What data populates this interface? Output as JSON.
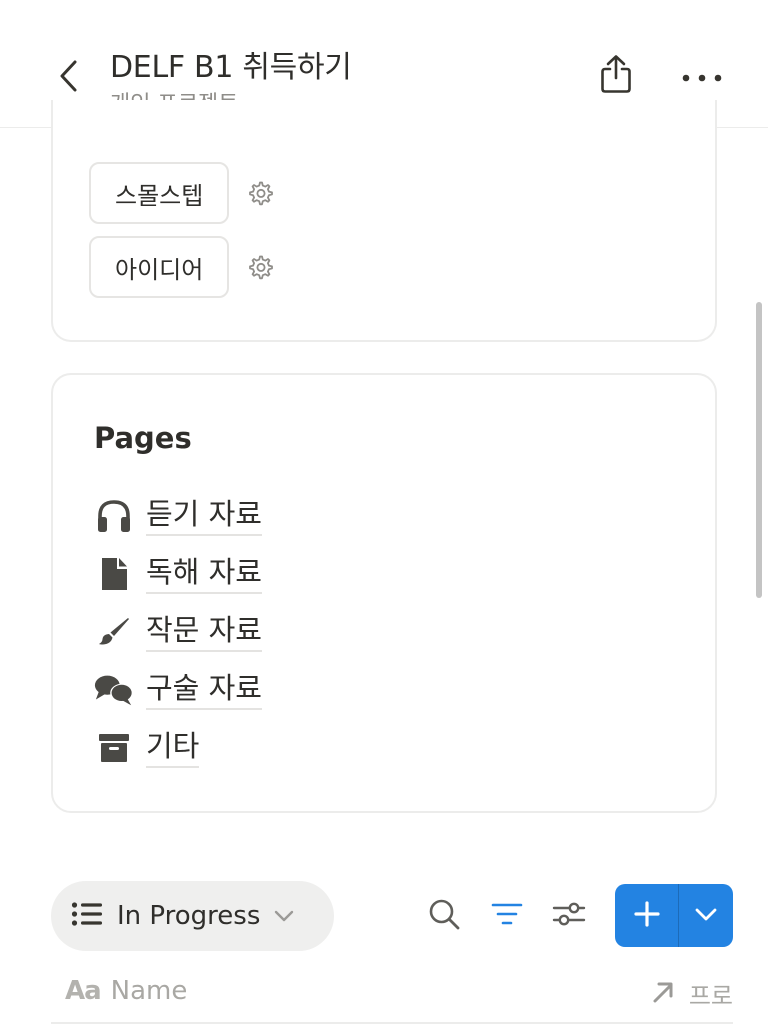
{
  "header": {
    "title": "DELF B1 취득하기",
    "subtitle": "개인 프로젝트",
    "icons": {
      "back": "chevron-left-icon",
      "share": "share-icon",
      "more": "more-horizontal-icon"
    }
  },
  "top_card": {
    "chips": [
      {
        "label": "스몰스텝",
        "icon": "gear-icon"
      },
      {
        "label": "아이디어",
        "icon": "gear-icon"
      }
    ]
  },
  "pages_card": {
    "heading": "Pages",
    "items": [
      {
        "label": "듣기 자료",
        "icon": "headphones-icon"
      },
      {
        "label": "독해 자료",
        "icon": "document-icon"
      },
      {
        "label": "작문 자료",
        "icon": "paintbrush-icon"
      },
      {
        "label": "구술 자료",
        "icon": "chat-bubbles-icon"
      },
      {
        "label": "기타",
        "icon": "archive-box-icon"
      }
    ]
  },
  "toolbar": {
    "view_label": "In Progress",
    "icons": {
      "view": "list-icon",
      "dropdown": "chevron-down-icon",
      "search": "search-icon",
      "filter": "filter-icon",
      "settings": "sliders-icon",
      "new": "plus-icon",
      "new_menu": "chevron-down-icon"
    }
  },
  "table": {
    "name_column": "Name",
    "right_column": "프로",
    "icons": {
      "name": "text-aa-icon",
      "right": "arrow-up-right-icon"
    }
  },
  "colors": {
    "accent": "#2383e2",
    "text": "#2f2e2b",
    "muted_text": "#8f8d89",
    "border": "#ececeb"
  }
}
